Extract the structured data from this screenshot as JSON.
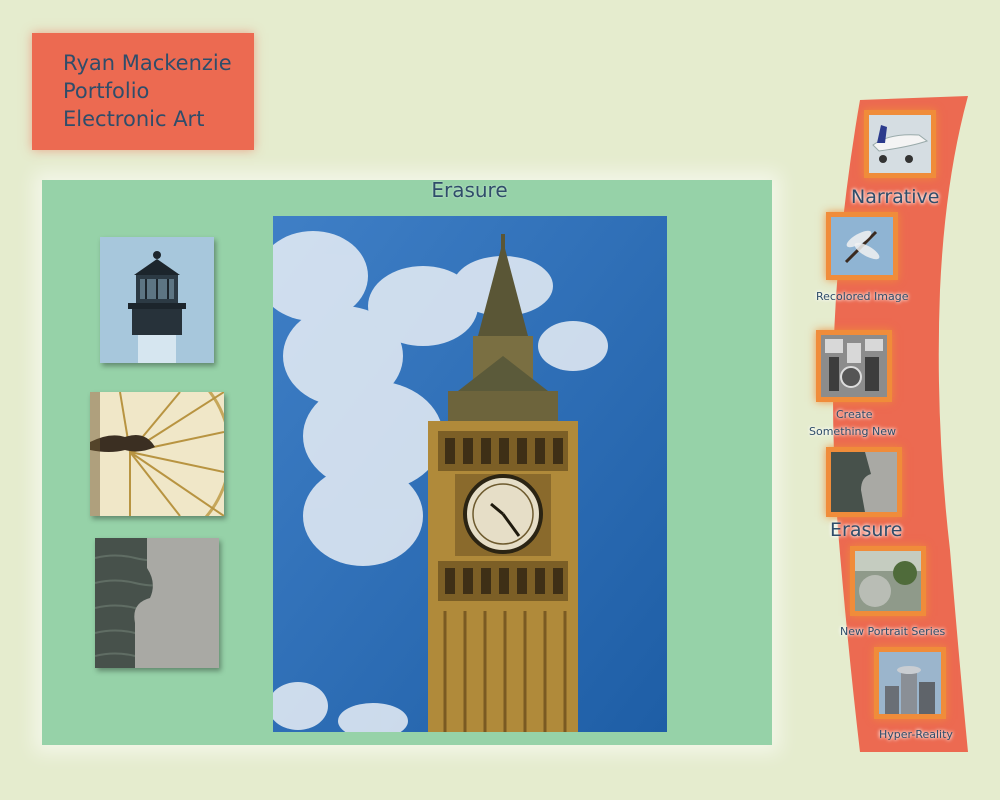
{
  "header": {
    "lines": [
      "Ryan Mackenzie",
      "Portfolio",
      "Electronic Art"
    ]
  },
  "gallery": {
    "title": "Erasure"
  },
  "nav": {
    "items": [
      {
        "label": "Narrative"
      },
      {
        "label": "Recolored Image"
      },
      {
        "label": "Create",
        "label2": "Something New"
      },
      {
        "label": "Erasure"
      },
      {
        "label": "New Portrait Series"
      },
      {
        "label": "Hyper-Reality"
      }
    ]
  },
  "colors": {
    "background": "#e5ecce",
    "header_box": "#ec6a51",
    "gallery_panel": "#96d2a8",
    "sidebar": "#ec6a51",
    "thumb_frame": "#f08c3a",
    "text": "#2f4d6a"
  }
}
